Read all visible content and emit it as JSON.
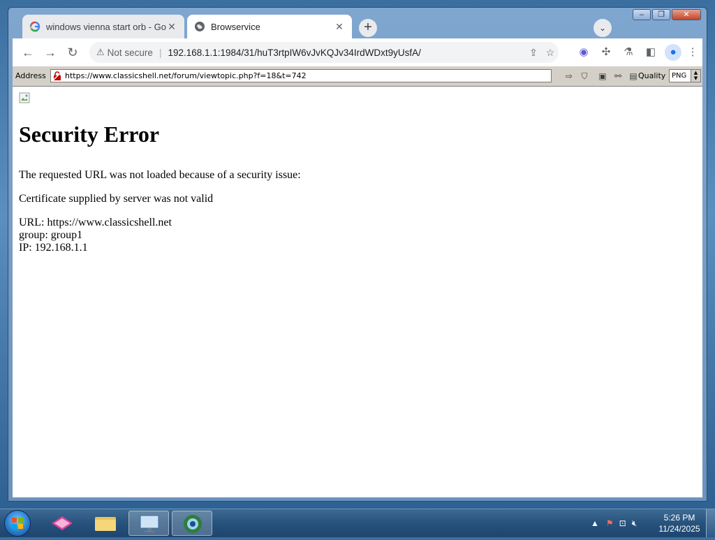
{
  "window": {
    "controls": [
      "–",
      "❐",
      "✕"
    ]
  },
  "tabs": [
    {
      "title": "windows vienna start orb - Goo",
      "active": false
    },
    {
      "title": "Browservice",
      "active": true
    }
  ],
  "newtab_label": "+",
  "omnibox": {
    "security_label": "Not secure",
    "url": "192.168.1.1:1984/31/huT3rtpIW6vJvKQJv34IrdWDxt9yUsfA/"
  },
  "browservice": {
    "address_label": "Address",
    "address_value": "https://www.classicshell.net/forum/viewtopic.php?f=18&t=742",
    "quality_label": "Quality",
    "quality_value": "PNG"
  },
  "page": {
    "heading": "Security Error",
    "line1": "The requested URL was not loaded because of a security issue:",
    "line2": "Certificate supplied by server was not valid",
    "url_line": "URL: https://www.classicshell.net",
    "group_line": "group: group1",
    "ip_line": "IP: 192.168.1.1"
  },
  "taskbar": {
    "time": "5:26 PM",
    "date": "11/24/2025"
  }
}
